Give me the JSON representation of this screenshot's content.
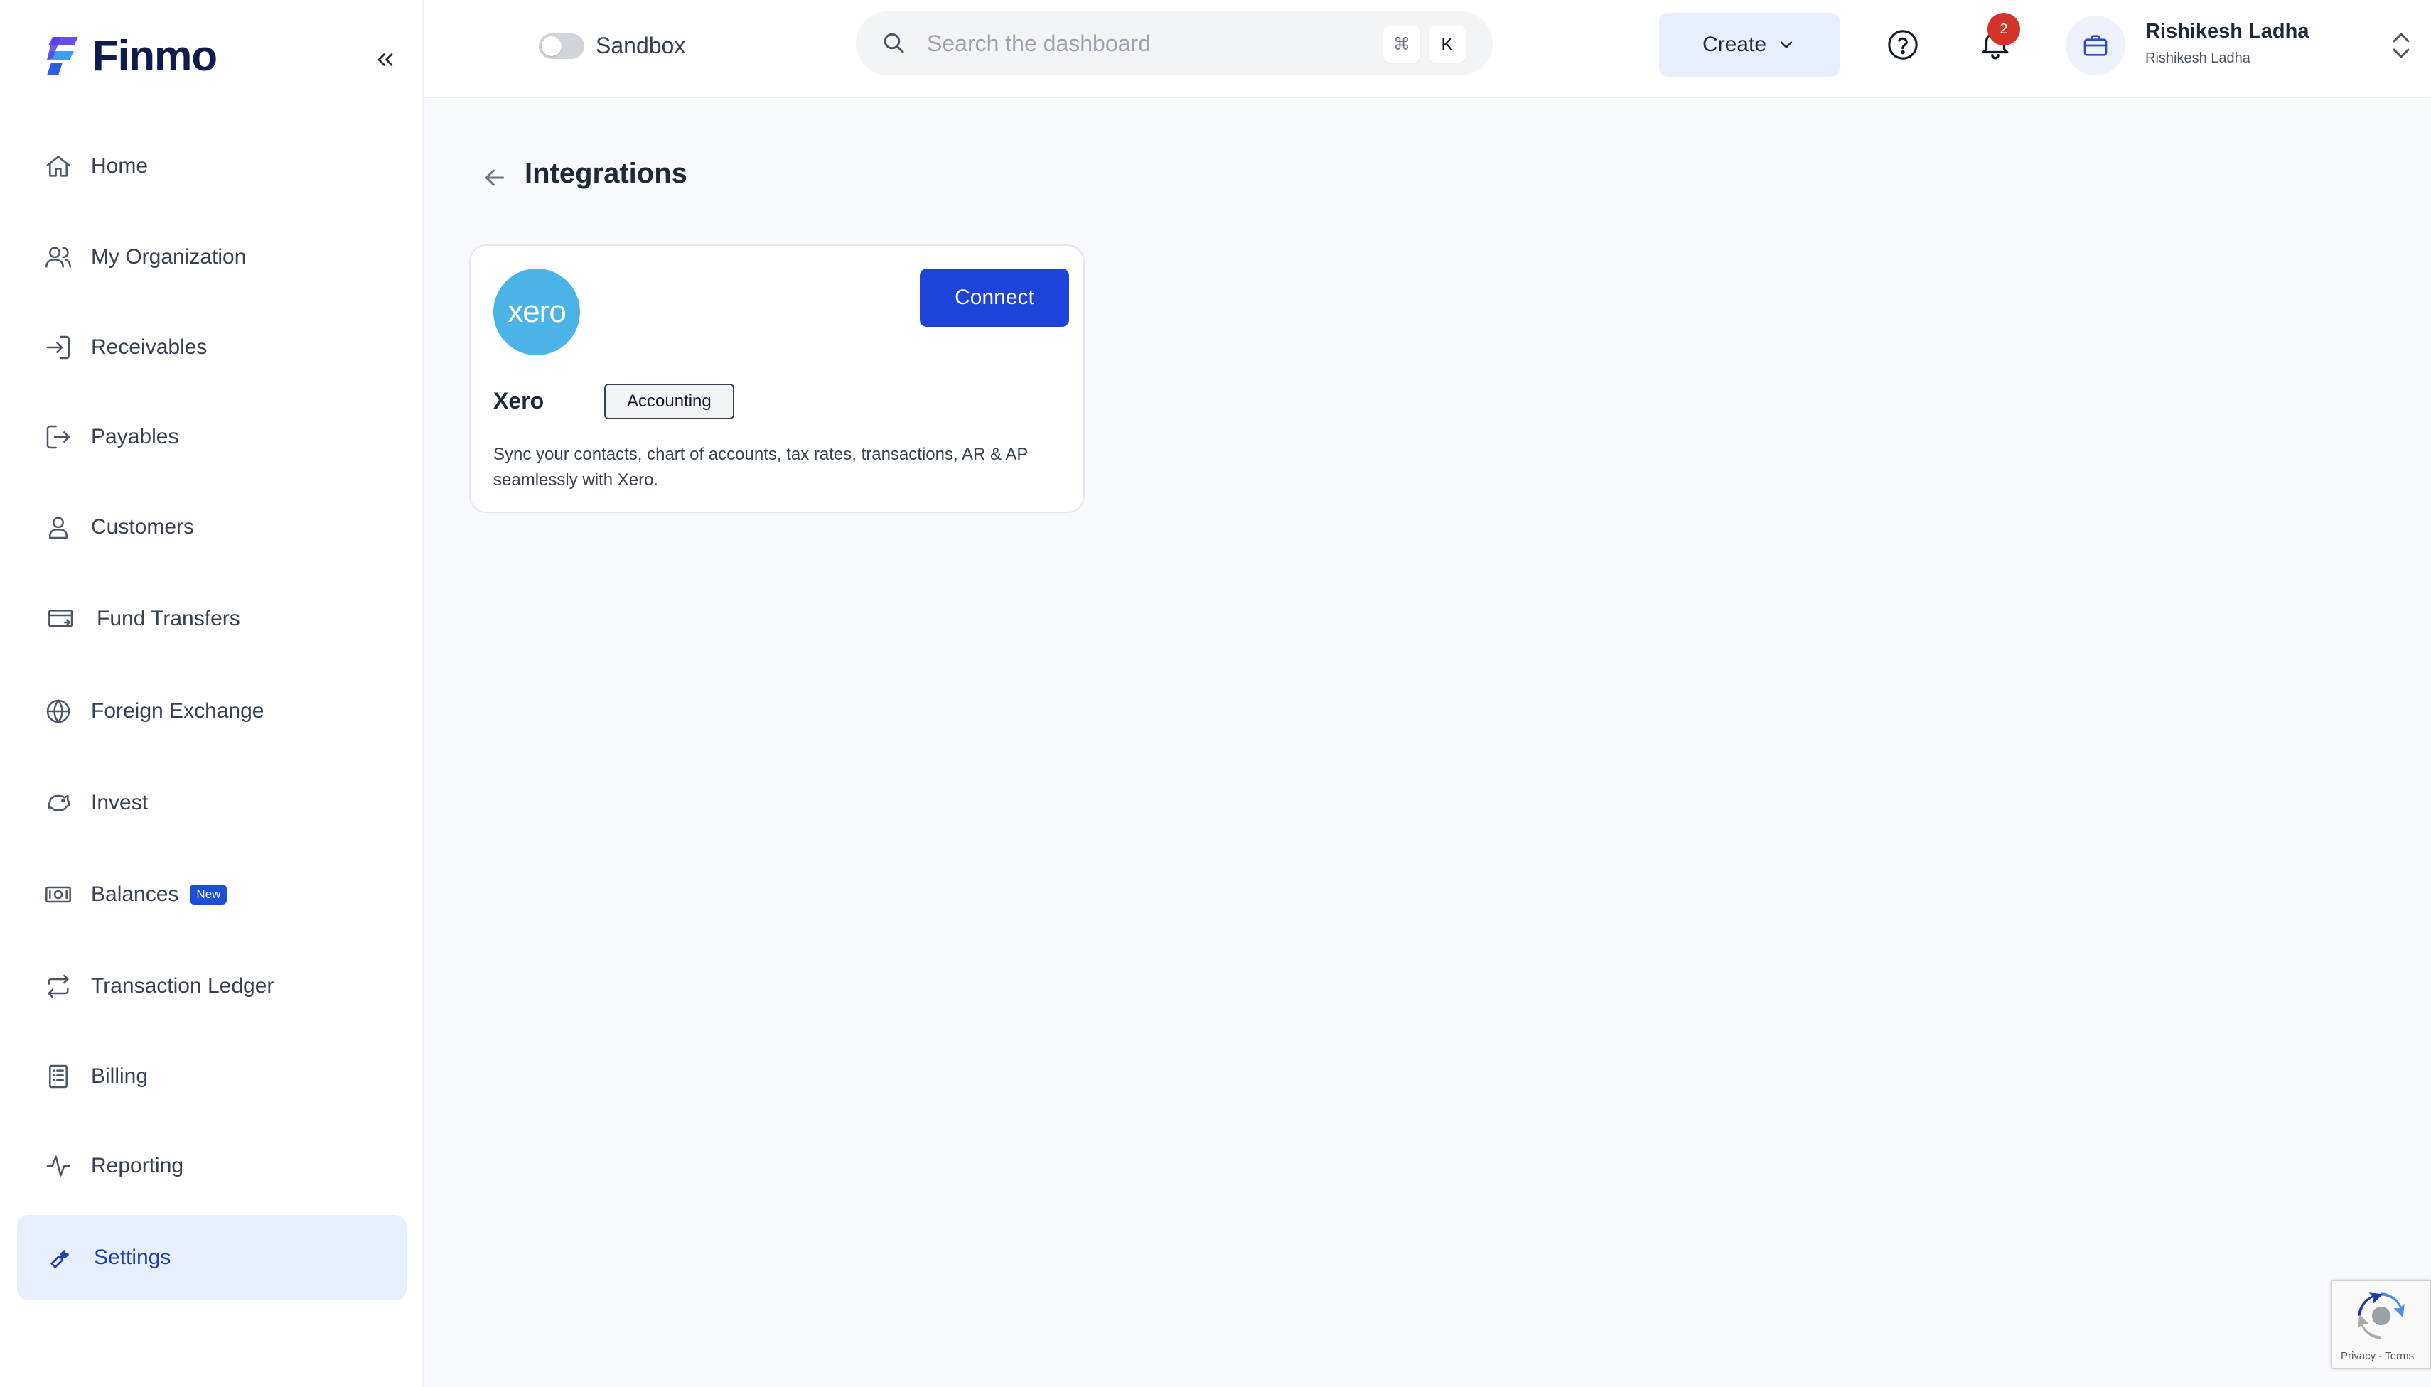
{
  "brand": {
    "name": "Finmo",
    "accent": "#1d43d8"
  },
  "sidebar": {
    "items": [
      {
        "label": "Home",
        "icon": "home-icon"
      },
      {
        "label": "My Organization",
        "icon": "users-icon"
      },
      {
        "label": "Receivables",
        "icon": "login-icon"
      },
      {
        "label": "Payables",
        "icon": "logout-icon"
      },
      {
        "label": "Customers",
        "icon": "user-icon"
      },
      {
        "label": "Fund Transfers",
        "icon": "card-transfer-icon"
      },
      {
        "label": "Foreign Exchange",
        "icon": "globe-icon"
      },
      {
        "label": "Invest",
        "icon": "piggy-bank-icon"
      },
      {
        "label": "Balances",
        "icon": "cash-icon",
        "badge": "New"
      },
      {
        "label": "Transaction Ledger",
        "icon": "repeat-icon"
      },
      {
        "label": "Billing",
        "icon": "receipt-icon"
      },
      {
        "label": "Reporting",
        "icon": "activity-icon"
      },
      {
        "label": "Settings",
        "icon": "wrench-icon",
        "active": true
      }
    ]
  },
  "topbar": {
    "sandbox_label": "Sandbox",
    "search_placeholder": "Search the dashboard",
    "shortcut_mod": "⌘",
    "shortcut_key": "K",
    "create_label": "Create",
    "notification_count": "2",
    "user_name": "Rishikesh Ladha",
    "org_name": "Rishikesh Ladha"
  },
  "page": {
    "title": "Integrations",
    "integrations": [
      {
        "logo_text": "xero",
        "name": "Xero",
        "tag": "Accounting",
        "description": "Sync your contacts, chart of accounts, tax rates, transactions, AR & AP seamlessly with Xero.",
        "action_label": "Connect"
      }
    ]
  },
  "recaptcha": {
    "links": "Privacy - Terms"
  }
}
